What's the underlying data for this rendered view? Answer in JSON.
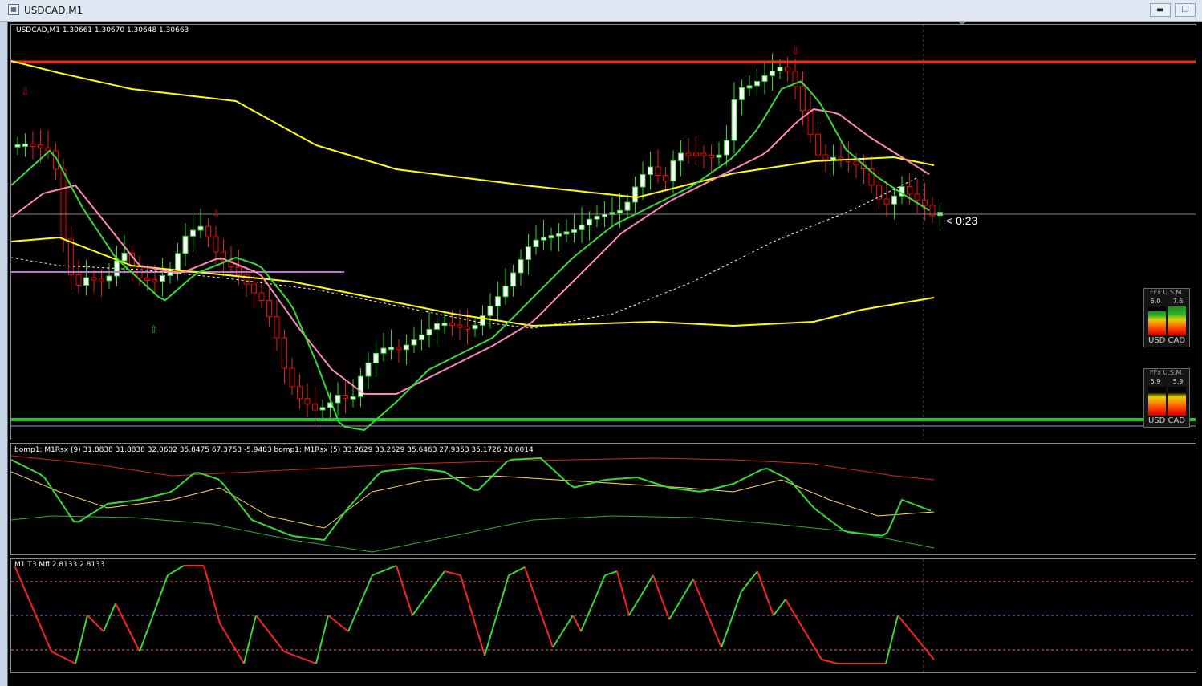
{
  "window": {
    "title": "USDCAD,M1",
    "minimize_label": "▬",
    "restore_label": "❐",
    "close_label": "✕"
  },
  "main_pane": {
    "header": "USDCAD,M1  1.30661 1.30670 1.30648 1.30663",
    "timer": "< 0:23"
  },
  "rsx_pane": {
    "header": "bomp1: M1Rsx (9) 31.8838 31.8838 32.0602 35.8475 67.3753 -5.9483  bomp1: M1Rsx (5) 33.2629 33.2629 35.6463 27.9353 35.1726 20.0014"
  },
  "mfi_pane": {
    "header": "M1  T3 Mfi  2.8133 2.8133"
  },
  "widgets": [
    {
      "title": "FFx U.S.M.",
      "v1": "6.0",
      "v2": "7.6",
      "pair": "USD CAD"
    },
    {
      "title": "FFx U.S.M.",
      "v1": "5.9",
      "v2": "5.9",
      "pair": "USD CAD"
    }
  ],
  "colors": {
    "background": "#000000",
    "bull_candle": "#ffffff",
    "bear_candle": "#ff0000",
    "resistance_line": "#ff2a00",
    "support_line": "#20d020",
    "ma_fast": "#33dd33",
    "ma_pink": "#ff88bb",
    "ma_yellow": "#ffff00"
  }
}
